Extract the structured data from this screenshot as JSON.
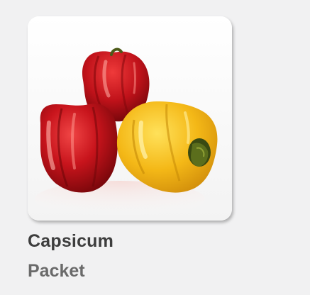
{
  "product": {
    "name": "Capsicum",
    "unit": "Packet",
    "image_icon": "bell-peppers-image",
    "colors": {
      "background": "#f1f1f2",
      "title": "#3d3d3d",
      "subtitle": "#6a6a6a",
      "pepper_red": "#c3141b",
      "pepper_yellow": "#f2b514"
    }
  }
}
